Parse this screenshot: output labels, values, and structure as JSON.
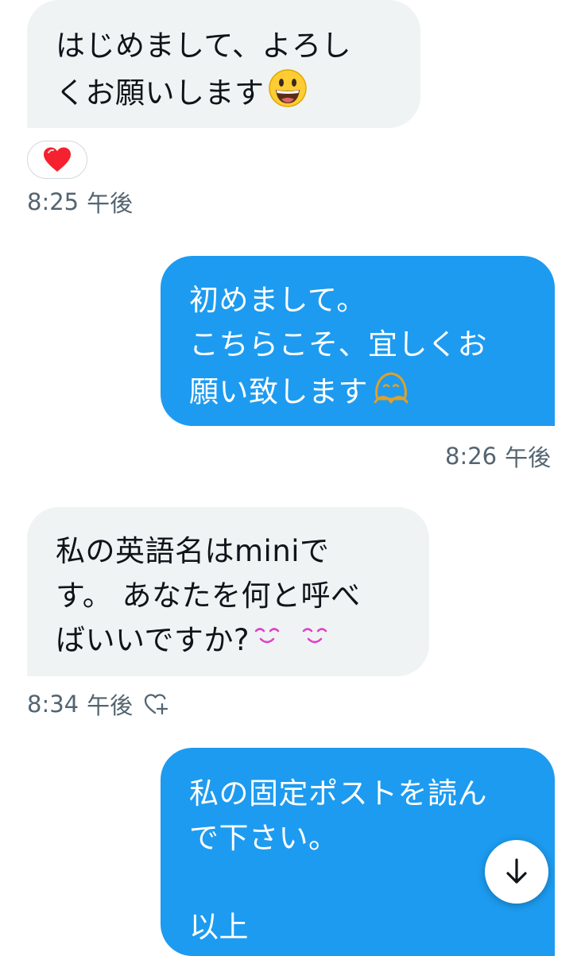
{
  "messages": [
    {
      "direction": "received",
      "lines": [
        "はじめまして、よろし",
        "くお願いします"
      ],
      "emoji": "grinning-face-emoji",
      "reaction": "heart-reaction-icon",
      "time": "8:25",
      "period": "午後"
    },
    {
      "direction": "sent",
      "lines": [
        "初めまして。",
        "こちらこそ、宜しくお",
        "願い致します"
      ],
      "emoji": "bowing-face-emoji",
      "time": "8:26",
      "period": "午後"
    },
    {
      "direction": "received",
      "lines": [
        "私の英語名はminiで",
        "す。 あなたを何と呼べ",
        "ばいいですか?"
      ],
      "emoji": "smiling-eyes-emoji",
      "time": "8:34",
      "period": "午後",
      "action_icon": "add-reaction-icon"
    },
    {
      "direction": "sent",
      "lines": [
        "私の固定ポストを読ん",
        "で下さい。",
        "",
        "以上"
      ]
    }
  ],
  "scroll_button_icon": "arrow-down-icon",
  "colors": {
    "sent_bubble": "#1d9bf0",
    "received_bubble": "#eff3f4",
    "meta_text": "#536471",
    "heart": "#f4212e"
  }
}
